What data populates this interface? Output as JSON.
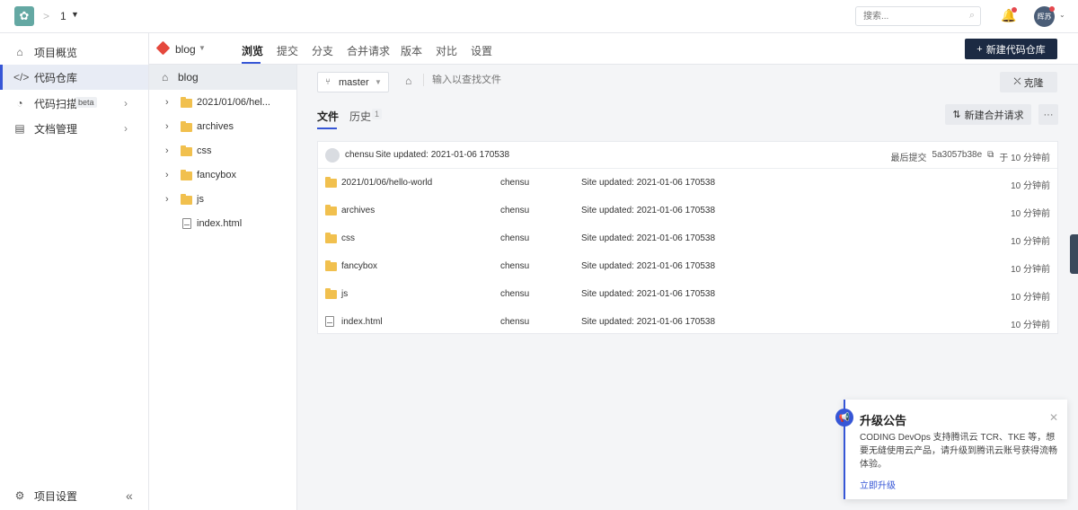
{
  "topbar": {
    "project_name": "1",
    "search_placeholder": "搜索...",
    "avatar_text": "辉苏"
  },
  "sidebar": {
    "items": [
      {
        "label": "项目概览",
        "icon": "home-icon"
      },
      {
        "label": "代码仓库",
        "icon": "code-icon"
      },
      {
        "label": "代码扫描",
        "icon": "scan-icon",
        "badge": "beta"
      },
      {
        "label": "文档管理",
        "icon": "doc-icon"
      }
    ],
    "settings_label": "项目设置"
  },
  "subnav": {
    "repo_name": "blog",
    "tabs": [
      "浏览",
      "提交",
      "分支",
      "合并请求",
      "版本",
      "对比",
      "设置"
    ],
    "new_repo_label": "新建代码仓库"
  },
  "tree": {
    "root": "blog",
    "items": [
      {
        "name": "2021/01/06/hel...",
        "type": "folder"
      },
      {
        "name": "archives",
        "type": "folder"
      },
      {
        "name": "css",
        "type": "folder"
      },
      {
        "name": "fancybox",
        "type": "folder"
      },
      {
        "name": "js",
        "type": "folder"
      },
      {
        "name": "index.html",
        "type": "file"
      }
    ]
  },
  "toolbar": {
    "branch": "master",
    "find_placeholder": "输入以查找文件",
    "clone_label": "克隆"
  },
  "file_tabs": {
    "files_label": "文件",
    "history_label": "历史",
    "history_count": "1",
    "new_mr_label": "新建合并请求",
    "more_label": "···"
  },
  "commit": {
    "author": "chensu",
    "message": "Site updated: 2021-01-06 170538",
    "last_commit_label": "最后提交",
    "hash": "5a3057b38e",
    "time": "于 10 分钟前"
  },
  "files": [
    {
      "name": "2021/01/06/hello-world",
      "type": "folder",
      "author": "chensu",
      "message": "Site updated: 2021-01-06 170538",
      "time": "10 分钟前"
    },
    {
      "name": "archives",
      "type": "folder",
      "author": "chensu",
      "message": "Site updated: 2021-01-06 170538",
      "time": "10 分钟前"
    },
    {
      "name": "css",
      "type": "folder",
      "author": "chensu",
      "message": "Site updated: 2021-01-06 170538",
      "time": "10 分钟前"
    },
    {
      "name": "fancybox",
      "type": "folder",
      "author": "chensu",
      "message": "Site updated: 2021-01-06 170538",
      "time": "10 分钟前"
    },
    {
      "name": "js",
      "type": "folder",
      "author": "chensu",
      "message": "Site updated: 2021-01-06 170538",
      "time": "10 分钟前"
    },
    {
      "name": "index.html",
      "type": "file",
      "author": "chensu",
      "message": "Site updated: 2021-01-06 170538",
      "time": "10 分钟前"
    }
  ],
  "notice": {
    "title": "升级公告",
    "body": "CODING DevOps 支持腾讯云 TCR、TKE 等，想要无缝使用云产品，请升级到腾讯云账号获得流畅体验。",
    "link": "立即升级"
  },
  "colors": {
    "accent": "#3656d6",
    "dark_button": "#1c2a43",
    "folder": "#f1c04e",
    "repo_icon": "#e5483d"
  }
}
